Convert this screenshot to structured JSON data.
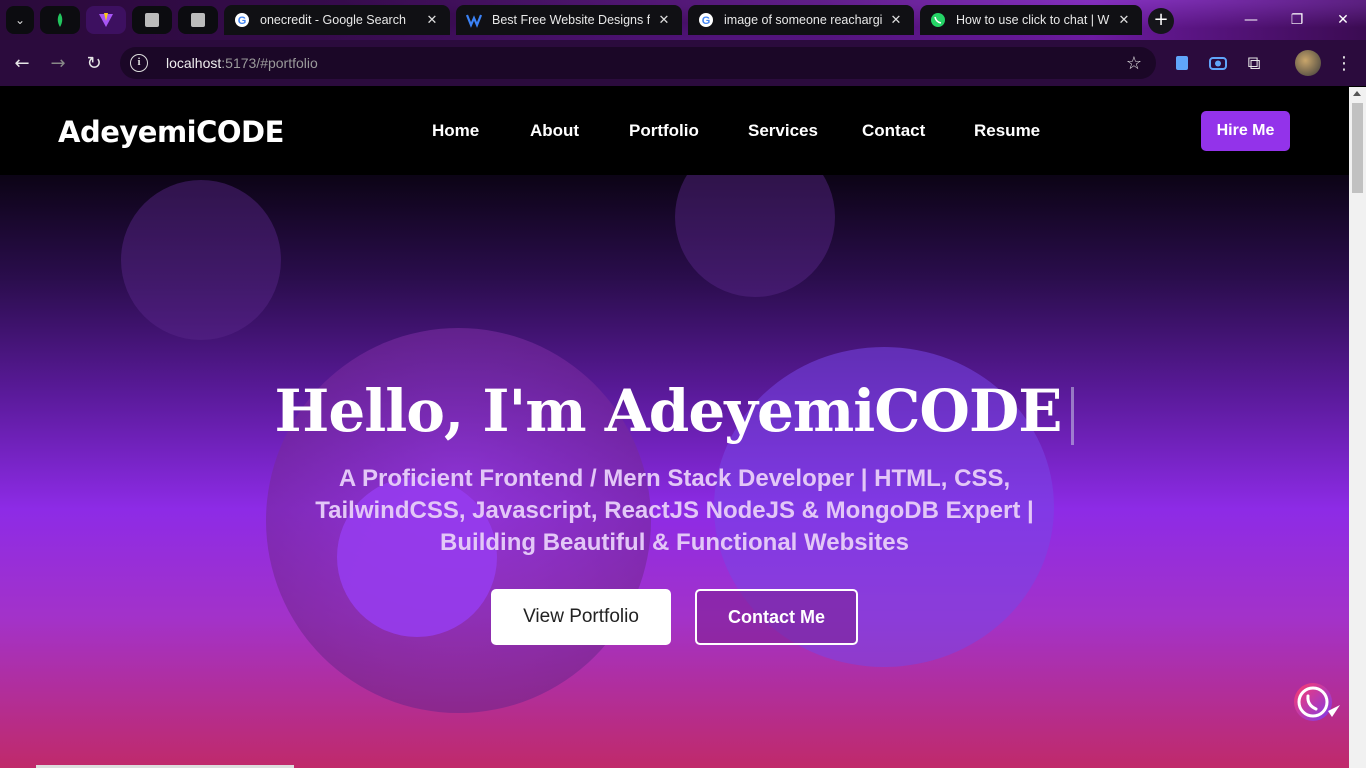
{
  "browser": {
    "tabs": [
      {
        "title": "onecredit - Google Search",
        "icon": "google-icon"
      },
      {
        "title": "Best Free Website Designs for",
        "icon": "webflow-icon"
      },
      {
        "title": "image of someone reacharging",
        "icon": "google-icon"
      },
      {
        "title": "How to use click to chat | Wha",
        "icon": "whatsapp-icon"
      }
    ],
    "url_host": "localhost",
    "url_rest": ":5173/#portfolio"
  },
  "site": {
    "logo": "AdeyemiCODE",
    "nav": [
      "Home",
      "About",
      "Portfolio",
      "Services",
      "Contact",
      "Resume"
    ],
    "hire_label": "Hire Me"
  },
  "hero": {
    "title": "Hello, I'm AdeyemiCODE",
    "subtitle": "A Proficient Frontend / Mern Stack Developer | HTML, CSS, TailwindCSS, Javascript, ReactJS NodeJS & MongoDB Expert | Building Beautiful & Functional Websites",
    "primary_button": "View Portfolio",
    "secondary_button": "Contact Me"
  },
  "colors": {
    "accent": "#9333ea",
    "nav_bg": "#000000"
  }
}
